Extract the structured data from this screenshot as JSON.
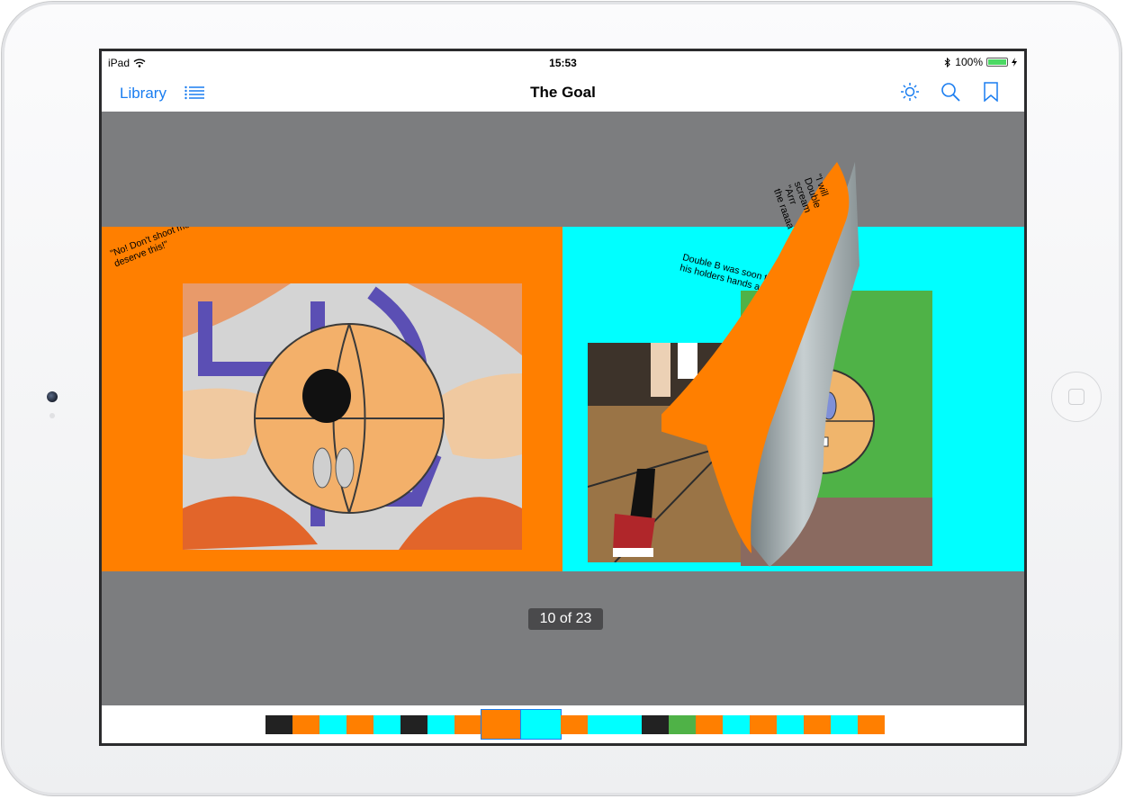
{
  "status_bar": {
    "device": "iPad",
    "time": "15:53",
    "battery": "100%"
  },
  "nav": {
    "library_label": "Library",
    "title": "The Goal",
    "icons": [
      "list-icon",
      "brightness-icon",
      "search-icon",
      "bookmark-icon"
    ]
  },
  "book": {
    "left_page": {
      "text": "\"No! Don't shoot me! I don't\ndeserve this!\"",
      "background": "#ff7f00"
    },
    "right_page": {
      "text": "Double B was soon to\nhis holders hands a",
      "background": "#00ffff"
    },
    "curl_text": "\"I will\nDouble\nscream\n\"Arrr\nthe raaaa"
  },
  "page_counter": "10 of 23",
  "colors": {
    "accent": "#1a7df0",
    "orange": "#ff7f00",
    "cyan": "#00ffff",
    "gray": "#7c7d7f"
  }
}
